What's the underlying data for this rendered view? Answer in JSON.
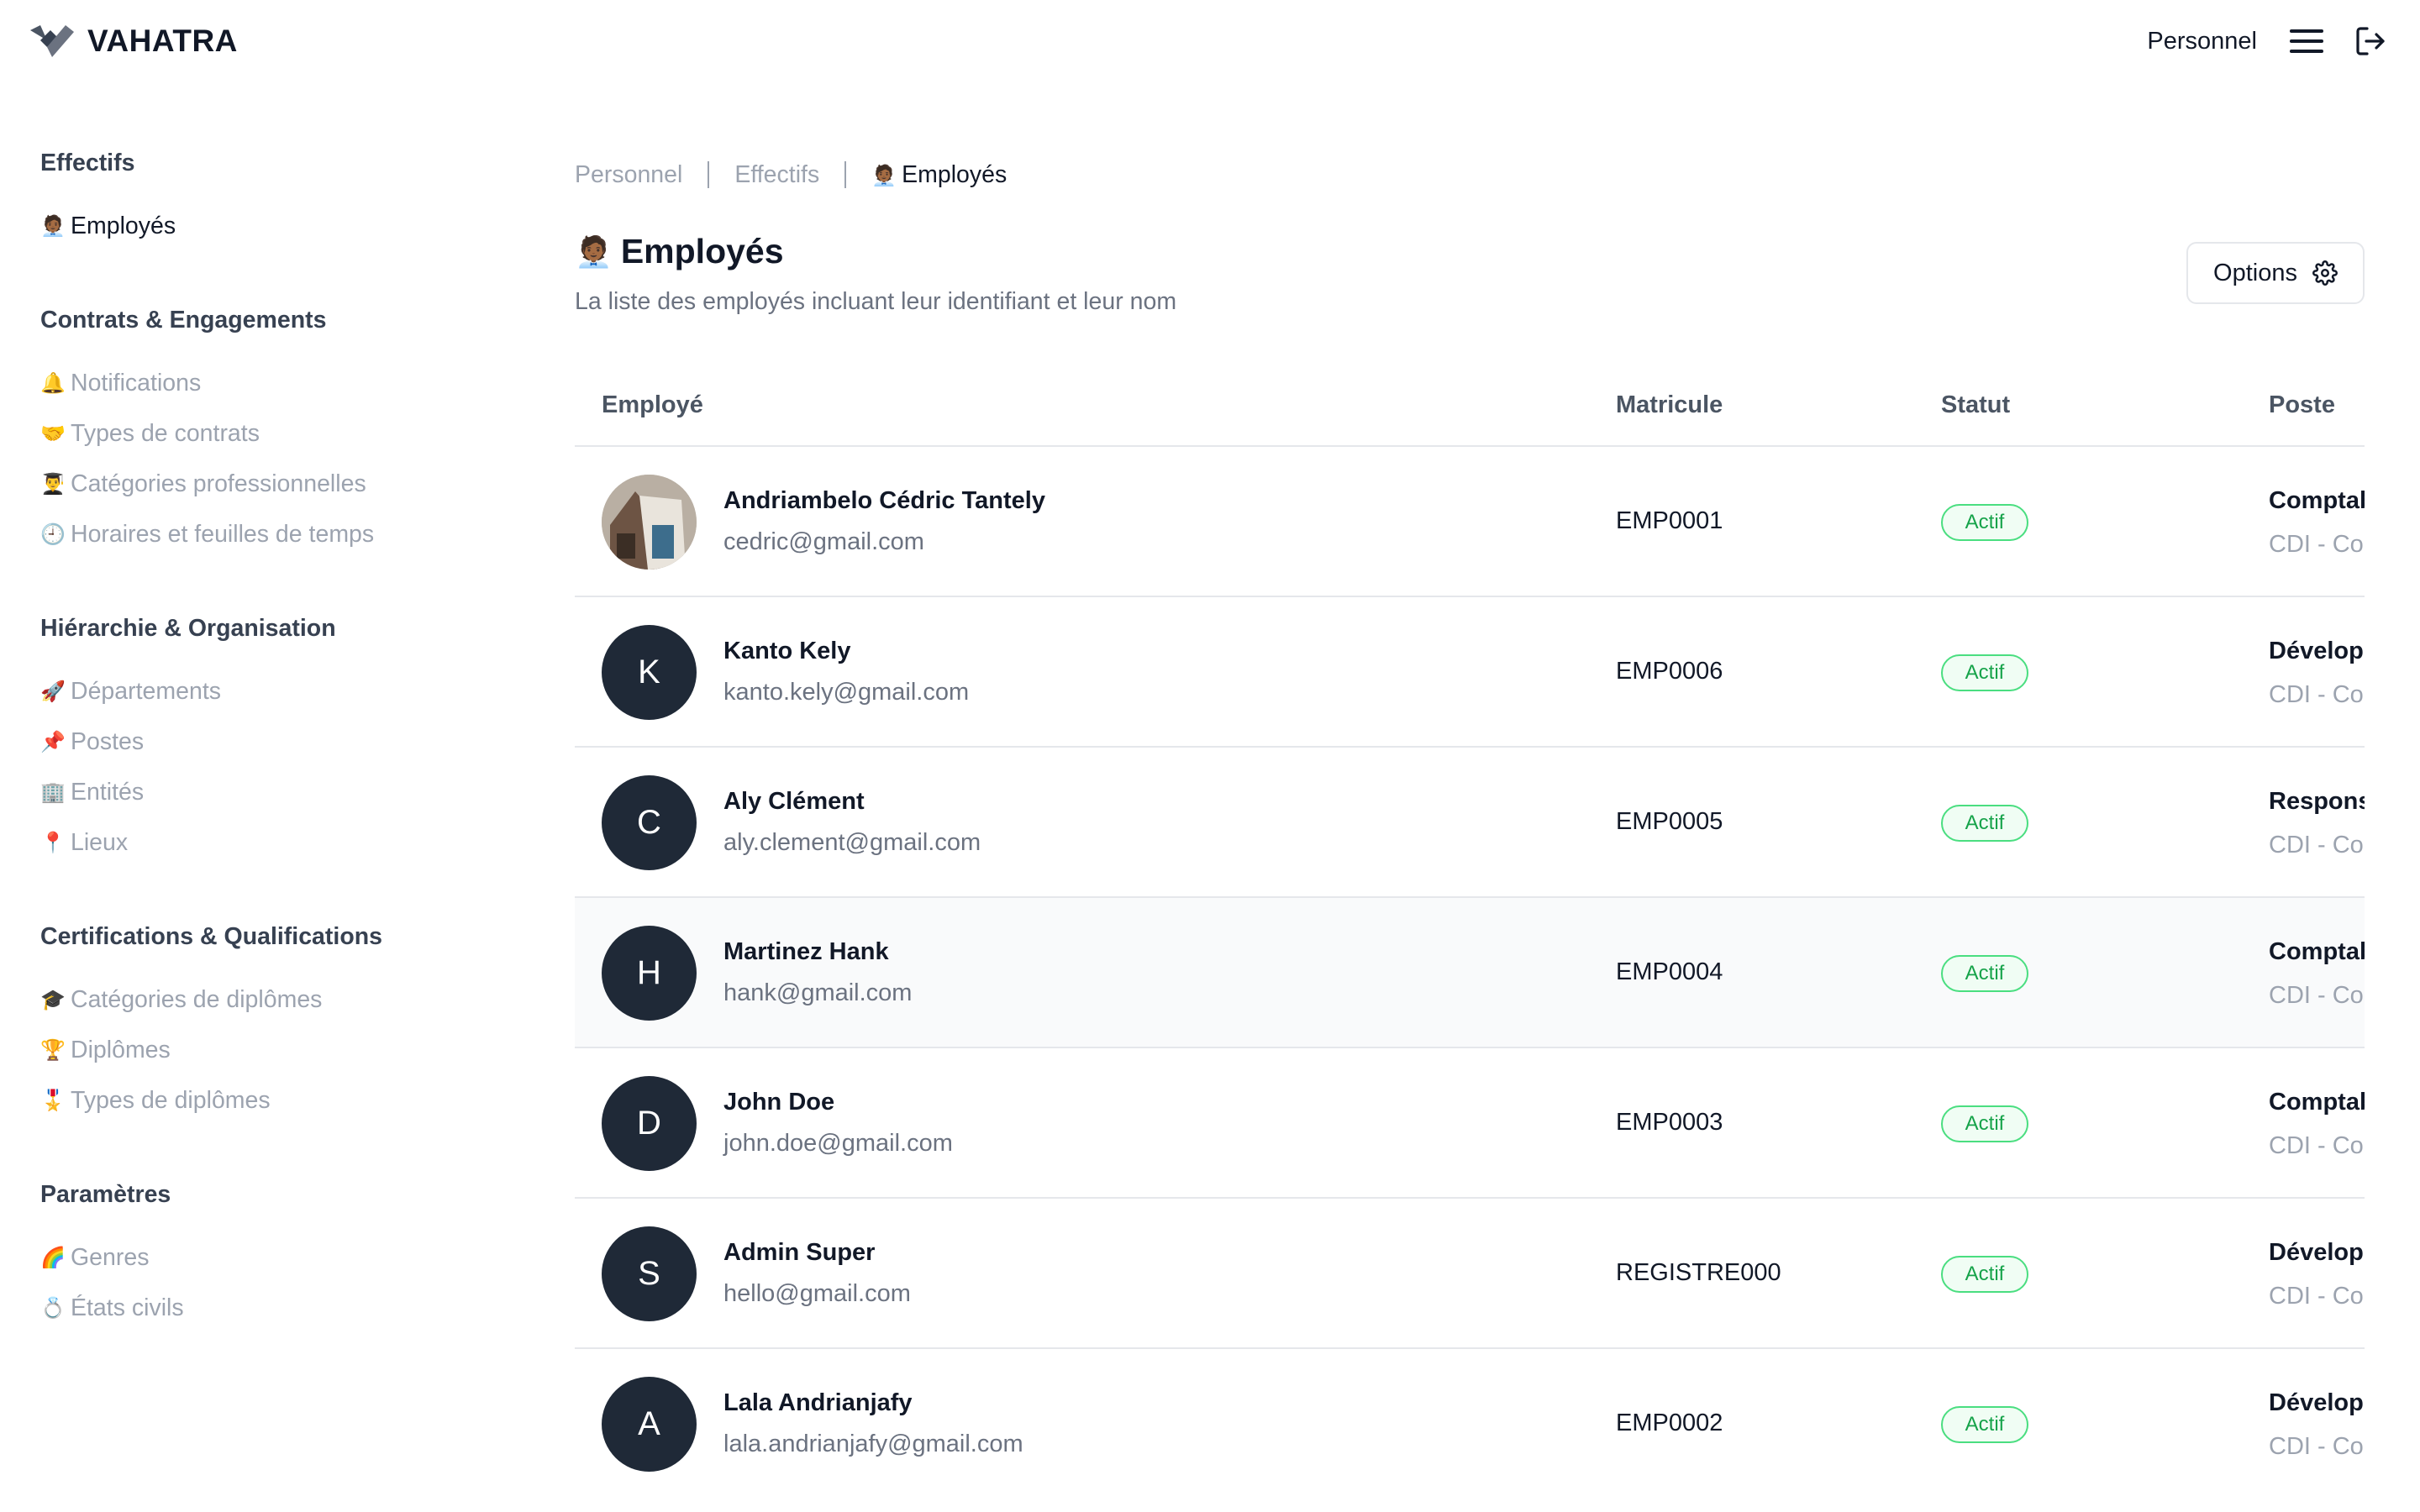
{
  "app": {
    "name": "VAHATRA",
    "module": "Personnel"
  },
  "sidebar": {
    "sections": [
      {
        "title": "Effectifs",
        "items": [
          {
            "emoji": "🧑🏾‍💼",
            "label": "Employés"
          }
        ]
      },
      {
        "title": "Contrats & Engagements",
        "items": [
          {
            "emoji": "🔔",
            "label": "Notifications"
          },
          {
            "emoji": "🤝",
            "label": "Types de contrats"
          },
          {
            "emoji": "👨‍🎓",
            "label": "Catégories professionnelles"
          },
          {
            "emoji": "🕘",
            "label": "Horaires et feuilles de temps"
          }
        ]
      },
      {
        "title": "Hiérarchie & Organisation",
        "items": [
          {
            "emoji": "🚀",
            "label": "Départements"
          },
          {
            "emoji": "📌",
            "label": "Postes"
          },
          {
            "emoji": "🏢",
            "label": "Entités"
          },
          {
            "emoji": "📍",
            "label": "Lieux"
          }
        ]
      },
      {
        "title": "Certifications & Qualifications",
        "items": [
          {
            "emoji": "🎓",
            "label": "Catégories de diplômes"
          },
          {
            "emoji": "🏆",
            "label": "Diplômes"
          },
          {
            "emoji": "🎖️",
            "label": "Types de diplômes"
          }
        ]
      },
      {
        "title": "Paramètres",
        "items": [
          {
            "emoji": "🌈",
            "label": "Genres"
          },
          {
            "emoji": "💍",
            "label": "États civils"
          }
        ]
      }
    ]
  },
  "breadcrumb": {
    "items": [
      {
        "label": "Personnel"
      },
      {
        "label": "Effectifs"
      },
      {
        "emoji": "🧑🏾‍💼",
        "label": "Employés"
      }
    ]
  },
  "page": {
    "emoji": "🧑🏾‍💼",
    "title": "Employés",
    "subtitle": "La liste des employés incluant leur identifiant et leur nom",
    "options_label": "Options"
  },
  "table": {
    "headers": {
      "employee": "Employé",
      "matricule": "Matricule",
      "statut": "Statut",
      "poste": "Poste"
    },
    "rows": [
      {
        "initial": "",
        "photo": true,
        "name": "Andriambelo Cédric Tantely",
        "email": "cedric@gmail.com",
        "matricule": "EMP0001",
        "status": "Actif",
        "poste": "Comptab",
        "contrat": "CDI - Cor"
      },
      {
        "initial": "K",
        "name": "Kanto Kely",
        "email": "kanto.kely@gmail.com",
        "matricule": "EMP0006",
        "status": "Actif",
        "poste": "Développ",
        "contrat": "CDI - Cor"
      },
      {
        "initial": "C",
        "name": "Aly Clément",
        "email": "aly.clement@gmail.com",
        "matricule": "EMP0005",
        "status": "Actif",
        "poste": "Responsa",
        "contrat": "CDI - Cor"
      },
      {
        "initial": "H",
        "name": "Martinez Hank",
        "email": "hank@gmail.com",
        "matricule": "EMP0004",
        "status": "Actif",
        "poste": "Comptab",
        "contrat": "CDI - Cor"
      },
      {
        "initial": "D",
        "name": "John Doe",
        "email": "john.doe@gmail.com",
        "matricule": "EMP0003",
        "status": "Actif",
        "poste": "Comptab",
        "contrat": "CDI - Cor"
      },
      {
        "initial": "S",
        "name": "Admin Super",
        "email": "hello@gmail.com",
        "matricule": "REGISTRE000",
        "status": "Actif",
        "poste": "Développ",
        "contrat": "CDI - Cor"
      },
      {
        "initial": "A",
        "name": "Lala Andrianjafy",
        "email": "lala.andrianjafy@gmail.com",
        "matricule": "EMP0002",
        "status": "Actif",
        "poste": "Développ",
        "contrat": "CDI - Cor"
      }
    ]
  },
  "colors": {
    "accent": "#111827",
    "avatar_bg": "#1f2937",
    "badge_border": "#4ade80",
    "badge_text": "#16a34a"
  },
  "icons": {
    "logo": "vahatra-logo-icon",
    "menu": "menu-icon",
    "logout": "logout-icon",
    "options": "gear-icon"
  }
}
